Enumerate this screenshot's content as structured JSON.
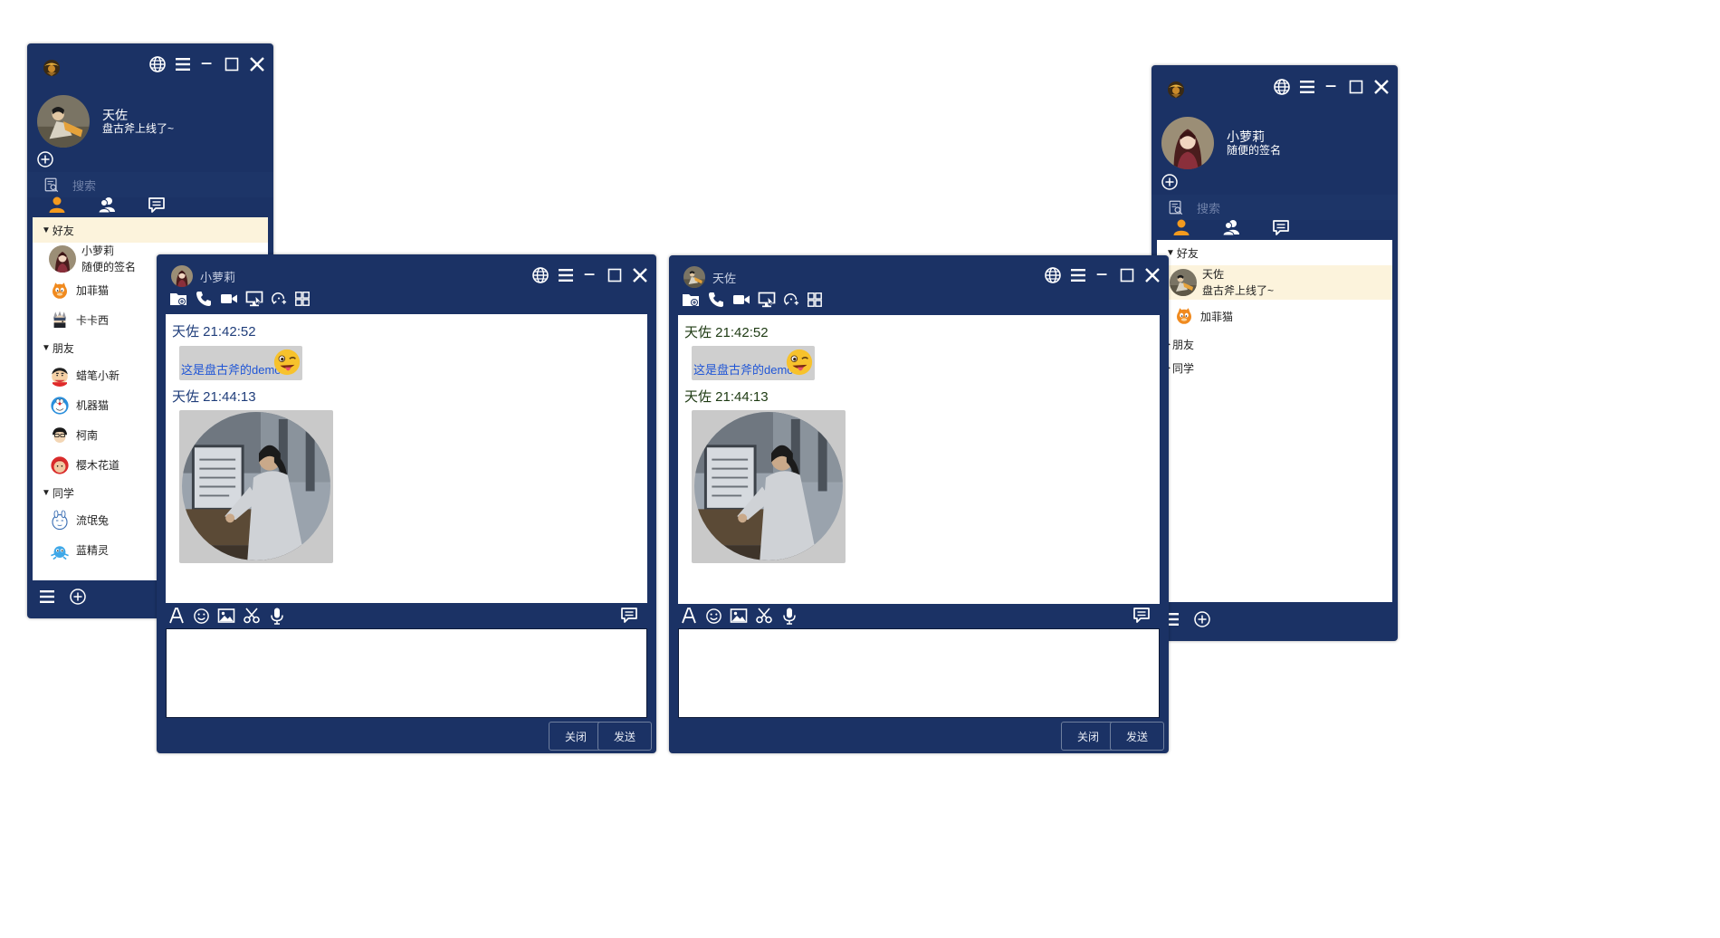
{
  "colors": {
    "window_bg": "#1b3265",
    "selected_row": "#fcf3dc",
    "link_text": "#1f55d6"
  },
  "left_window": {
    "user_name": "天佐",
    "signature": "盘古斧上线了~",
    "search_placeholder": "搜索",
    "groups": [
      {
        "name": "好友",
        "friends": [
          {
            "name": "小萝莉",
            "signature": "随便的签名"
          },
          {
            "name": "加菲猫"
          },
          {
            "name": "卡卡西"
          }
        ]
      },
      {
        "name": "朋友",
        "friends": [
          {
            "name": "蜡笔小新"
          },
          {
            "name": "机器猫"
          },
          {
            "name": "柯南"
          },
          {
            "name": "樱木花道"
          }
        ]
      },
      {
        "name": "同学",
        "friends": [
          {
            "name": "流氓兔"
          },
          {
            "name": "蓝精灵"
          }
        ]
      }
    ]
  },
  "right_window": {
    "user_name": "小萝莉",
    "signature": "随便的签名",
    "search_placeholder": "搜索",
    "groups": [
      {
        "name": "好友",
        "friends": [
          {
            "name": "天佐",
            "signature": "盘古斧上线了~"
          },
          {
            "name": "加菲猫"
          }
        ]
      },
      {
        "name": "朋友"
      },
      {
        "name": "同学"
      }
    ]
  },
  "chat_left": {
    "title": "小萝莉",
    "messages": [
      {
        "header": "天佐 21:42:52",
        "text": "这是盘古斧的demo"
      },
      {
        "header": "天佐 21:44:13",
        "image": "image-message"
      }
    ],
    "close_label": "关闭",
    "send_label": "发送"
  },
  "chat_right": {
    "title": "天佐",
    "messages": [
      {
        "header": "天佐 21:42:52",
        "text": "这是盘古斧的demo"
      },
      {
        "header": "天佐 21:44:13",
        "image": "image-message"
      }
    ],
    "close_label": "关闭",
    "send_label": "发送"
  }
}
